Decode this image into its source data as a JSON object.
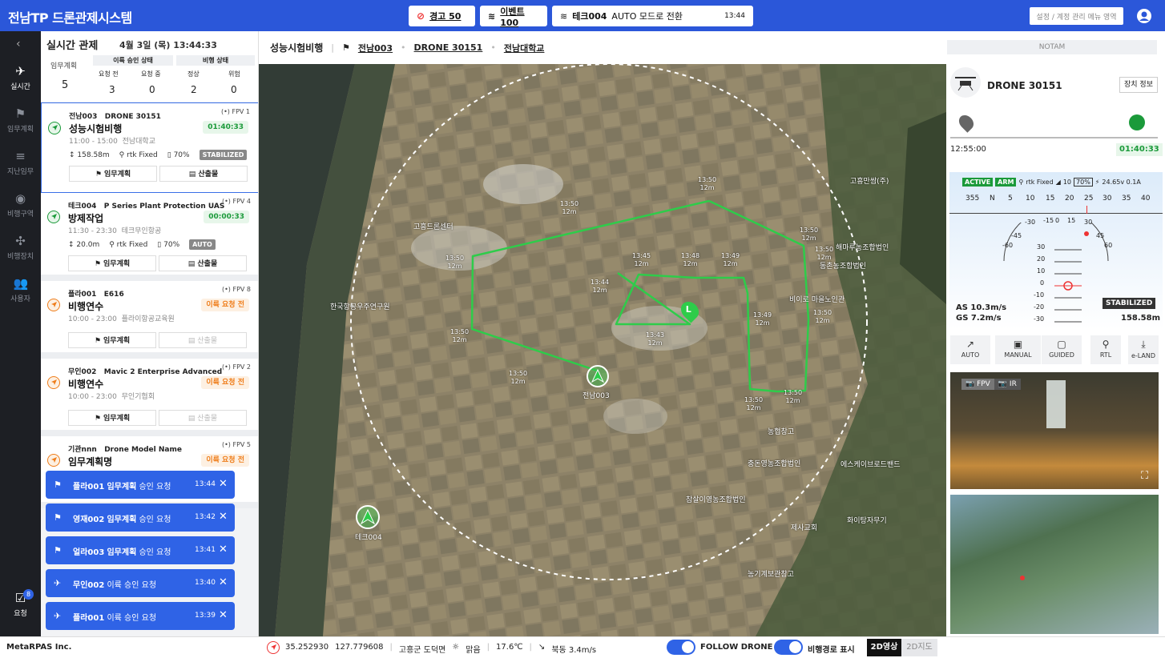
{
  "app": {
    "title": "전남TP 드론관제시스템",
    "account_placeholder": "설정 / 계정 관리 메뉴 영역"
  },
  "topbar": {
    "warning": "경고 50",
    "event": "이벤트 100",
    "notify_drone": "테크004",
    "notify_text": "AUTO 모드로 전환",
    "notify_time": "13:44"
  },
  "nav": {
    "items": [
      "실시간",
      "임무계획",
      "지난임무",
      "비행구역",
      "비행장치",
      "사용자"
    ],
    "request_label": "요청",
    "request_count": "8"
  },
  "panel": {
    "title": "실시간 관제",
    "datetime": "4월 3일 (목) 13:44:33",
    "plan_label": "임무계획",
    "plan_value": "5",
    "approval_label": "이륙 승인 상태",
    "flight_label": "비행 상태",
    "cols": [
      "요청 전",
      "요청 중",
      "정상",
      "위험"
    ],
    "values": [
      "3",
      "0",
      "2",
      "0"
    ]
  },
  "cards": [
    {
      "org": "전남003",
      "drone": "DRONE 30151",
      "name": "성능시험비행",
      "time": "11:00 - 15:00",
      "place": "전남대학교",
      "fpv": "FPV 1",
      "badge": "01:40:33",
      "alt": "158.58m",
      "gps": "rtk Fixed",
      "battery": "70%",
      "mode": "STABILIZED",
      "btn1": "임무계획",
      "btn2": "산출물"
    },
    {
      "org": "테크004",
      "drone": "P Series Plant Protection UAS",
      "name": "방제작업",
      "time": "11:30 - 23:30",
      "place": "테크무인항공",
      "fpv": "FPV 4",
      "badge": "00:00:33",
      "alt": "20.0m",
      "gps": "rtk Fixed",
      "battery": "70%",
      "mode": "AUTO",
      "btn1": "임무계획",
      "btn2": "산출물"
    },
    {
      "org": "플라001",
      "drone": "E616",
      "name": "비행연수",
      "time": "10:00 - 23:00",
      "place": "플라이항공교육원",
      "fpv": "FPV 8",
      "badge": "이륙 요청 전",
      "btn1": "임무계획",
      "btn2": "산출물"
    },
    {
      "org": "무인002",
      "drone": "Mavic 2 Enterprise Advanced",
      "name": "비행연수",
      "time": "10:00 - 23:00",
      "place": "무인기협회",
      "fpv": "FPV 2",
      "badge": "이륙 요청 전",
      "btn1": "임무계획",
      "btn2": "산출물"
    },
    {
      "org": "기관nnn",
      "drone": "Drone Model Name",
      "name": "임무계획명",
      "fpv": "FPV 5",
      "badge": "이륙 요청 전"
    }
  ],
  "toasts": [
    {
      "org": "플라001",
      "bold": "임무계획",
      "text": "승인 요청",
      "time": "13:44"
    },
    {
      "org": "영재002",
      "bold": "임무계획",
      "text": "승인 요청",
      "time": "13:42"
    },
    {
      "org": "얼라003",
      "bold": "임무계획",
      "text": "승인 요청",
      "time": "13:41"
    },
    {
      "org": "무인002",
      "bold": "",
      "text": "이륙 승인 요청",
      "time": "13:40"
    },
    {
      "org": "플라001",
      "bold": "",
      "text": "이륙 승인 요청",
      "time": "13:39"
    }
  ],
  "map": {
    "title": "성능시험비행",
    "crumbs": [
      "전남003",
      "DRONE 30151",
      "전남대학교"
    ],
    "waypoint_alt": "12m",
    "waypoint_times": [
      "13:50",
      "13:50",
      "13:50",
      "13:50",
      "13:50",
      "13:50",
      "13:50",
      "13:50",
      "13:50",
      "13:50",
      "13:49",
      "13:49",
      "13:48",
      "13:47",
      "13:45",
      "13:44",
      "13:43"
    ],
    "drone1": "전남003",
    "drone2": "테크004",
    "home": "L",
    "places": [
      "고흥드론센터",
      "고흥만쌈(주)",
      "해마루농조합법인",
      "한국항공우주연구원",
      "비이로 마을노인관",
      "농협창고",
      "충돈영농조합법인",
      "에스케이브로드밴드",
      "참살이영농조합법인",
      "제사교회",
      "화이탕자무기",
      "농기계보관창고",
      "동촌농조합법인"
    ]
  },
  "status": {
    "company": "MetaRPAS Inc.",
    "lat": "35.252930",
    "lng": "127.779608",
    "region": "고흥군 도덕면",
    "weather": "맑음",
    "temp": "17.6℃",
    "wind": "북동 3.4m/s",
    "follow": "FOLLOW DRONE",
    "route": "비행경로 표시",
    "view_on": "2D영상",
    "view_off": "2D지도"
  },
  "drone": {
    "notam": "NOTAM",
    "name": "DRONE 30151",
    "info_btn": "장치 정보",
    "start_time": "12:55:00",
    "elapsed": "01:40:33",
    "active": "ACTIVE",
    "arm": "ARM",
    "gps": "rtk Fixed",
    "sats": "10",
    "battery": "70%",
    "power": "24.65v 0.1A",
    "heading": [
      "355",
      "N",
      "5",
      "10",
      "15",
      "20",
      "25",
      "30",
      "35",
      "40"
    ],
    "roll": [
      "-30",
      "-15",
      "0",
      "15",
      "30",
      "-45",
      "45",
      "-60",
      "60"
    ],
    "pitch": [
      "30",
      "20",
      "10",
      "0",
      "-10",
      "-20",
      "-30"
    ],
    "as": "AS 10.3m/s",
    "gs": "GS 7.2m/s",
    "mode": "STABILIZED",
    "alt": "158.58m",
    "modes": [
      "AUTO",
      "MANUAL",
      "GUIDED",
      "RTL",
      "e-LAND"
    ],
    "cam_tabs": [
      "FPV",
      "IR"
    ]
  },
  "colors": {
    "brand": "#2b57d9",
    "route": "#2ecc4a",
    "ok": "#1b9a3a",
    "warn": "#ef7d1a"
  }
}
